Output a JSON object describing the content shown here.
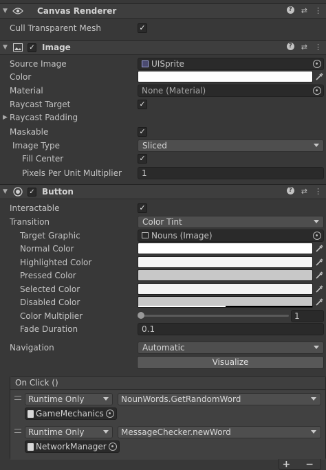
{
  "canvas_renderer": {
    "title": "Canvas Renderer",
    "cull_label": "Cull Transparent Mesh",
    "cull_checked": true
  },
  "image": {
    "title": "Image",
    "source_image_label": "Source Image",
    "source_image_value": "UISprite",
    "color_label": "Color",
    "color_value": "#ffffff",
    "material_label": "Material",
    "material_value": "None (Material)",
    "raycast_target_label": "Raycast Target",
    "raycast_padding_label": "Raycast Padding",
    "maskable_label": "Maskable",
    "image_type_label": "Image Type",
    "image_type_value": "Sliced",
    "fill_center_label": "Fill Center",
    "ppu_label": "Pixels Per Unit Multiplier",
    "ppu_value": "1"
  },
  "button": {
    "title": "Button",
    "interactable_label": "Interactable",
    "transition_label": "Transition",
    "transition_value": "Color Tint",
    "target_graphic_label": "Target Graphic",
    "target_graphic_value": "Nouns (Image)",
    "normal_color_label": "Normal Color",
    "highlighted_color_label": "Highlighted Color",
    "pressed_color_label": "Pressed Color",
    "selected_color_label": "Selected Color",
    "disabled_color_label": "Disabled Color",
    "color_multiplier_label": "Color Multiplier",
    "color_multiplier_value": "1",
    "fade_duration_label": "Fade Duration",
    "fade_duration_value": "0.1",
    "navigation_label": "Navigation",
    "navigation_value": "Automatic",
    "visualize_label": "Visualize"
  },
  "on_click": {
    "header": "On Click ()",
    "listeners": [
      {
        "mode": "Runtime Only",
        "function": "NounWords.GetRandomWord",
        "target": "GameMechanics"
      },
      {
        "mode": "Runtime Only",
        "function": "MessageChecker.newWord",
        "target": "NetworkManager"
      }
    ],
    "add_label": "+",
    "remove_label": "−"
  },
  "colors": {
    "normal": "#ffffff",
    "highlighted": "#f5f5f5",
    "pressed": "#c8c8c8",
    "selected": "#f5f5f5",
    "disabled": "#c8c8c8"
  }
}
